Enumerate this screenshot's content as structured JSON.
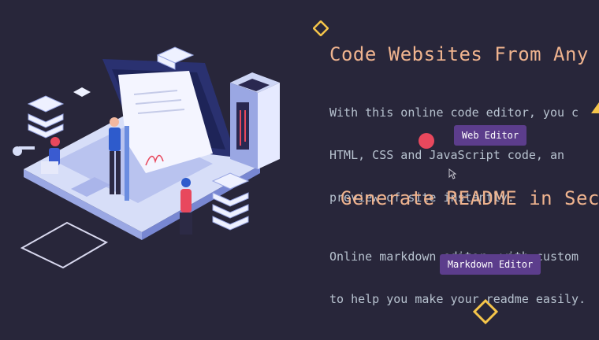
{
  "section1": {
    "heading": "Code Websites From Any W",
    "description_lines": [
      "With this online code editor, you c",
      "HTML, CSS and JavaScript code, an",
      "preview of site instantly."
    ],
    "button_label": "Web Editor"
  },
  "section2": {
    "heading": "Generate README in Seco",
    "description_lines": [
      "Online markdown editor, with custom",
      "to help you make your readme easily."
    ],
    "button_label": "Markdown Editor"
  },
  "colors": {
    "background": "#28263a",
    "heading": "#f0b48f",
    "body_text": "#b7c2cf",
    "button": "#5c3d8c",
    "diamond_accent": "#f5c54a",
    "dot_accent": "#e8485d"
  },
  "icons": [
    "hero-illustration",
    "diamond-icon",
    "dot-icon",
    "triangle-icon",
    "mouse-cursor-icon"
  ]
}
